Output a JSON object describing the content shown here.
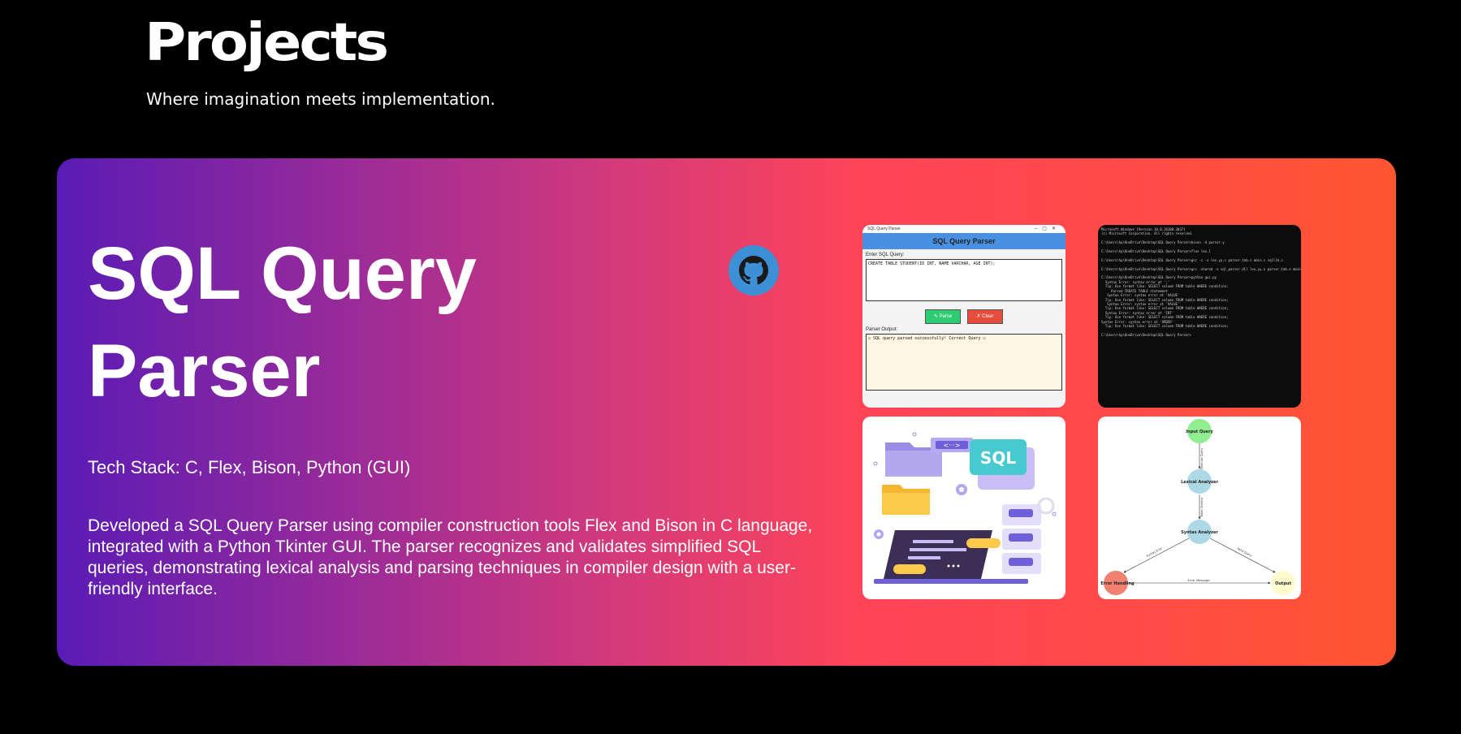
{
  "section": {
    "title": "Projects",
    "subtitle": "Where imagination meets implementation."
  },
  "project": {
    "title": "SQL Query Parser",
    "tech_stack": "Tech Stack: C, Flex, Bison, Python (GUI)",
    "description": "Developed a SQL Query Parser using compiler construction tools Flex and Bison in C language, integrated with a Python Tkinter GUI. The parser recognizes and validates simplified SQL queries, demonstrating lexical analysis and parsing techniques in compiler design with a user-friendly interface.",
    "github_icon": "github-icon"
  },
  "gui_screenshot": {
    "window_title": "SQL Query Parser",
    "header": "SQL Query Parser",
    "input_label": "Enter SQL Query:",
    "input_value": "CREATE TABLE STUDENT(ID INT, NAME VARCHAR, AGE INT);",
    "parse_button": "✎ Parse",
    "clear_button": "✗ Clear",
    "output_label": "Parser Output:",
    "output_value": "☑ SQL query parsed successfully! Correct Query ☑"
  },
  "terminal_screenshot": {
    "lines": "Microsoft Windows [Version 10.0.26100.3037]\n(c) Microsoft Corporation. All rights reserved.\n\nC:\\Users\\hp\\OneDrive\\Desktop\\SQL Query Parser>bison -d parser.y\n\nC:\\Users\\hp\\OneDrive\\Desktop\\SQL Query Parser>flex lex.l\n\nC:\\Users\\hp\\OneDrive\\Desktop\\SQL Query Parser>gcc -c -o lex.yy.c parser.tab.c main.c sqllib.c\n\nC:\\Users\\hp\\OneDrive\\Desktop\\SQL Query Parser>gcc -shared -o sql_parser.dll lex.yy.o parser.tab.o main.o sqllib.o\n\nC:\\Users\\hp\\OneDrive\\Desktop\\SQL Query Parser>python gui.py\n  Syntax Error: syntax error at ';'\n  Tip: Use format like: SELECT column FROM table WHERE condition;\n     Parsed CREATE TABLE statement\n   Syntax Error: syntax error at 'VALUE'\n  Tip: Use format like: SELECT column FROM table WHERE condition;\n   Syntax Error: syntax error at 'VALUE'\n  Tip: Use format like: SELECT column FROM table WHERE condition;\n  Syntax Error: syntax error at 'INT'\n  Tip: Use format like: SELECT column FROM table WHERE condition;\nSyntax Error: syntax error at 'ORDER'\n  Tip: Use format like: SELECT column FROM table WHERE condition;\n\nC:\\Users\\hp\\OneDrive\\Desktop\\SQL Query Parser>"
  },
  "illustration": {
    "sql_label": "SQL",
    "code_tag": "<···>"
  },
  "flow_diagram": {
    "nodes": {
      "input": "Input Query",
      "lexer": "Lexical Analyzer",
      "parser": "Syntax Analyzer",
      "error": "Error Handling",
      "output": "Output"
    },
    "edges": {
      "tokenize": "Tokenize Query",
      "tokens": "Token Stream",
      "syntax_error": "Syntax Error",
      "valid_query": "Valid Query",
      "error_message": "Error Message"
    },
    "colors": {
      "input": "#90ee90",
      "lexer": "#add8e6",
      "parser": "#add8e6",
      "error": "#f08070",
      "output": "#fffacd"
    }
  },
  "colors": {
    "gradient_start": "#5a1bb5",
    "gradient_mid": "#ff4458",
    "gradient_end": "#ff5530",
    "github_blue": "#3d8fd6"
  }
}
